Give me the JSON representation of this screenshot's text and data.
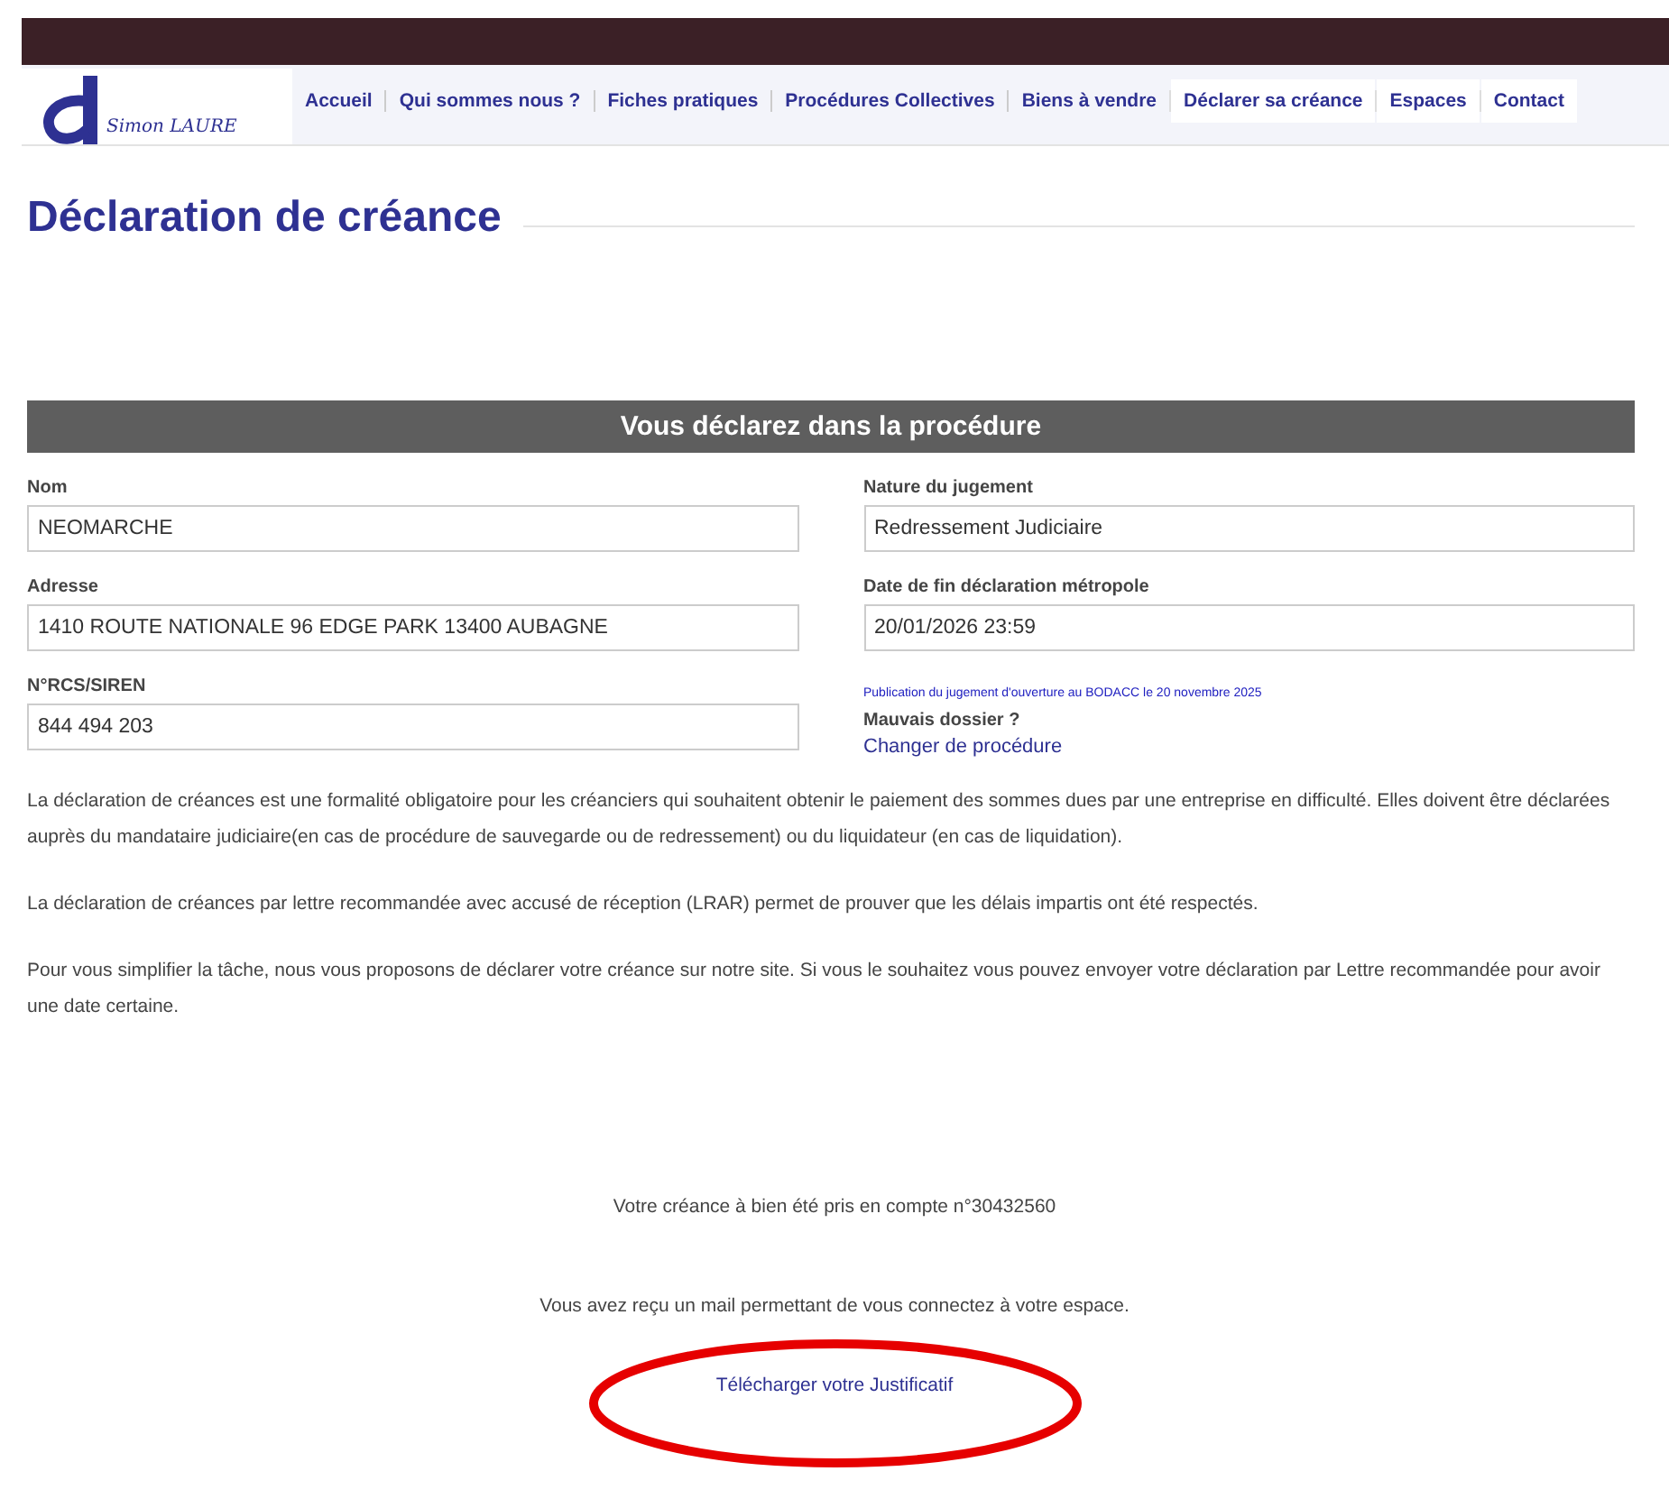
{
  "logo": {
    "text": "Simon LAURE"
  },
  "nav": [
    {
      "label": "Accueil",
      "selected": false
    },
    {
      "label": "Qui sommes nous ?",
      "selected": false
    },
    {
      "label": "Fiches pratiques",
      "selected": false
    },
    {
      "label": "Procédures Collectives",
      "selected": false
    },
    {
      "label": "Biens à vendre",
      "selected": false
    },
    {
      "label": "Déclarer sa créance",
      "selected": true
    },
    {
      "label": "Espaces",
      "selected": true
    },
    {
      "label": "Contact",
      "selected": true
    }
  ],
  "page_title": "Déclaration de créance",
  "panel": {
    "title": "Vous déclarez dans la procédure",
    "left_fields": [
      {
        "label": "Nom",
        "value": "NEOMARCHE"
      },
      {
        "label": "Adresse",
        "value": "1410 ROUTE NATIONALE 96 EDGE PARK 13400 AUBAGNE"
      },
      {
        "label": "N°RCS/SIREN",
        "value": "844 494 203"
      }
    ],
    "right_fields": [
      {
        "label": "Nature du jugement",
        "value": "Redressement Judiciaire"
      },
      {
        "label": "Date de fin déclaration métropole",
        "value": "20/01/2026 23:59"
      }
    ],
    "publication": "Publication du jugement d'ouverture au BODACC le 20 novembre 2025",
    "wrong_file": "Mauvais dossier ?",
    "change_link": "Changer de procédure"
  },
  "paragraphs": [
    "La déclaration de créances est une formalité obligatoire pour les créanciers qui souhaitent obtenir le paiement des sommes dues par une entreprise en difficulté. Elles doivent être déclarées auprès du mandataire judiciaire(en cas de procédure de sauvegarde ou de redressement) ou du liquidateur (en cas de liquidation).",
    "La déclaration de créances par lettre recommandée avec accusé de réception (LRAR) permet de prouver que les délais impartis ont été respectés.",
    "Pour vous simplifier la tâche, nous vous proposons de déclarer votre créance sur notre site. Si vous le souhaitez vous pouvez envoyer votre déclaration par Lettre recommandée pour avoir une date certaine."
  ],
  "confirmation": "Votre créance à bien été pris en compte n°30432560",
  "mail_notice": "Vous avez reçu un mail permettant de vous connectez à votre espace.",
  "download_link": "Télécharger votre Justificatif"
}
